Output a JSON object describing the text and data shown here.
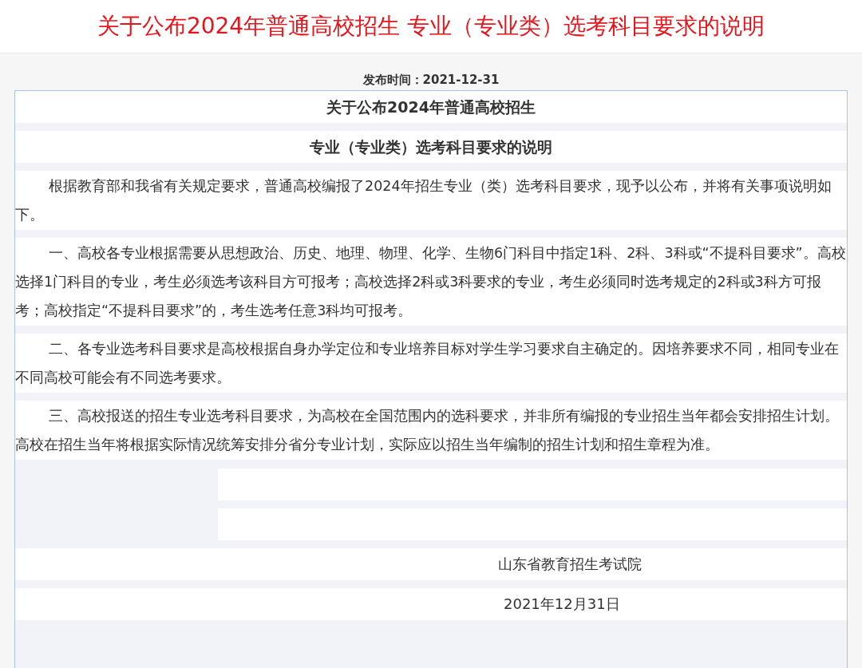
{
  "page_title": "关于公布2024年普通高校招生 专业（专业类）选考科目要求的说明",
  "publish_time": "发布时间：2021-12-31",
  "article": {
    "headings": [
      "关于公布2024年普通高校招生",
      "专业（专业类）选考科目要求的说明"
    ],
    "paragraphs": [
      "根据教育部和我省有关规定要求，普通高校编报了2024年招生专业（类）选考科目要求，现予以公布，并将有关事项说明如下。",
      "一、高校各专业根据需要从思想政治、历史、地理、物理、化学、生物6门科目中指定1科、2科、3科或“不提科目要求”。高校选择1门科目的专业，考生必须选考该科目方可报考；高校选择2科或3科要求的专业，考生必须同时选考规定的2科或3科方可报考；高校指定“不提科目要求”的，考生选考任意3科均可报考。",
      "二、各专业选考科目要求是高校根据自身办学定位和专业培养目标对学生学习要求自主确定的。因培养要求不同，相同专业在不同高校可能会有不同选考要求。",
      "三、高校报送的招生专业选考科目要求，为高校在全国范围内的选科要求，并非所有编报的专业招生当年都会安排招生计划。高校在招生当年将根据实际情况统筹安排分省分专业计划，实际应以招生当年编制的招生计划和招生章程为准。"
    ],
    "signature": {
      "organization": "山东省教育招生考试院",
      "date": "2021年12月31日"
    }
  }
}
